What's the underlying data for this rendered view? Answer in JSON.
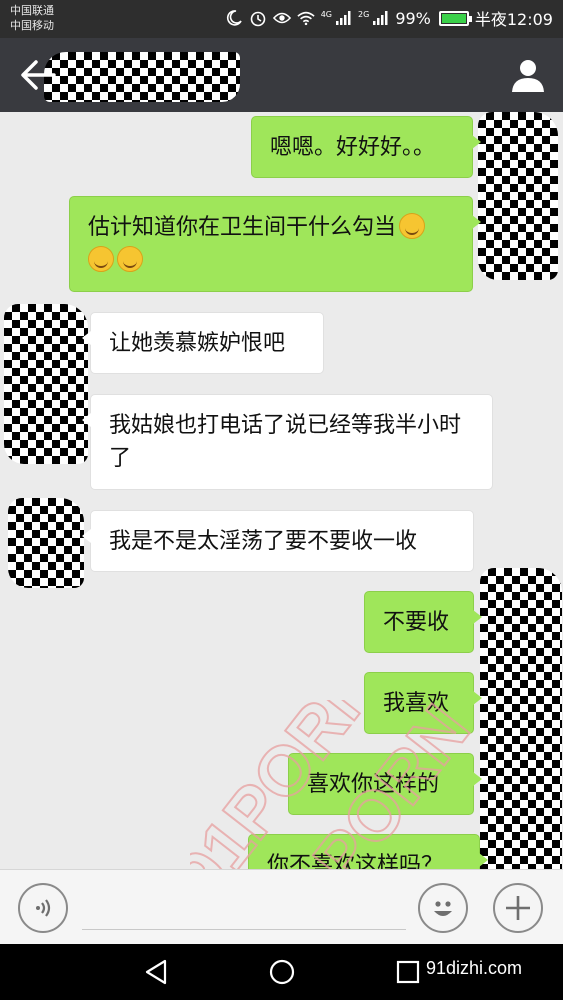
{
  "status_bar": {
    "carriers": [
      "中国联通",
      "中国移动"
    ],
    "network_tag_1": "4G",
    "network_tag_2": "2G",
    "battery": "99%",
    "battery_level": 0.99,
    "time": "半夜12:09"
  },
  "header": {
    "back_icon": "arrow-left-icon",
    "profile_icon": "person-icon"
  },
  "messages": [
    {
      "side": "right",
      "text": "嗯嗯。好好好。。"
    },
    {
      "side": "right",
      "text": "估计知道你在卫生间干什么勾当",
      "emoji_count": 3
    },
    {
      "side": "left",
      "text": "让她羡慕嫉妒恨吧"
    },
    {
      "side": "left",
      "text": "我姑娘也打电话了说已经等我半小时了"
    },
    {
      "side": "left",
      "text": "我是不是太淫荡了要不要收一收"
    },
    {
      "side": "right",
      "text": "不要收"
    },
    {
      "side": "right",
      "text": "我喜欢"
    },
    {
      "side": "right",
      "text": "喜欢你这样的"
    },
    {
      "side": "right",
      "text": "你不喜欢这样吗？"
    }
  ],
  "watermark": "91PORN",
  "input_bar": {
    "voice_icon": "voice-icon",
    "emoji_icon": "smiley-icon",
    "plus_icon": "plus-icon",
    "text_value": ""
  },
  "nav_bar": {
    "site": "91dizhi.com"
  },
  "colors": {
    "status_bg": "#2e2e2e",
    "title_bg": "#393a3f",
    "chat_bg": "#ebebeb",
    "my_bubble": "#9fe65a",
    "their_bubble": "#ffffff"
  }
}
